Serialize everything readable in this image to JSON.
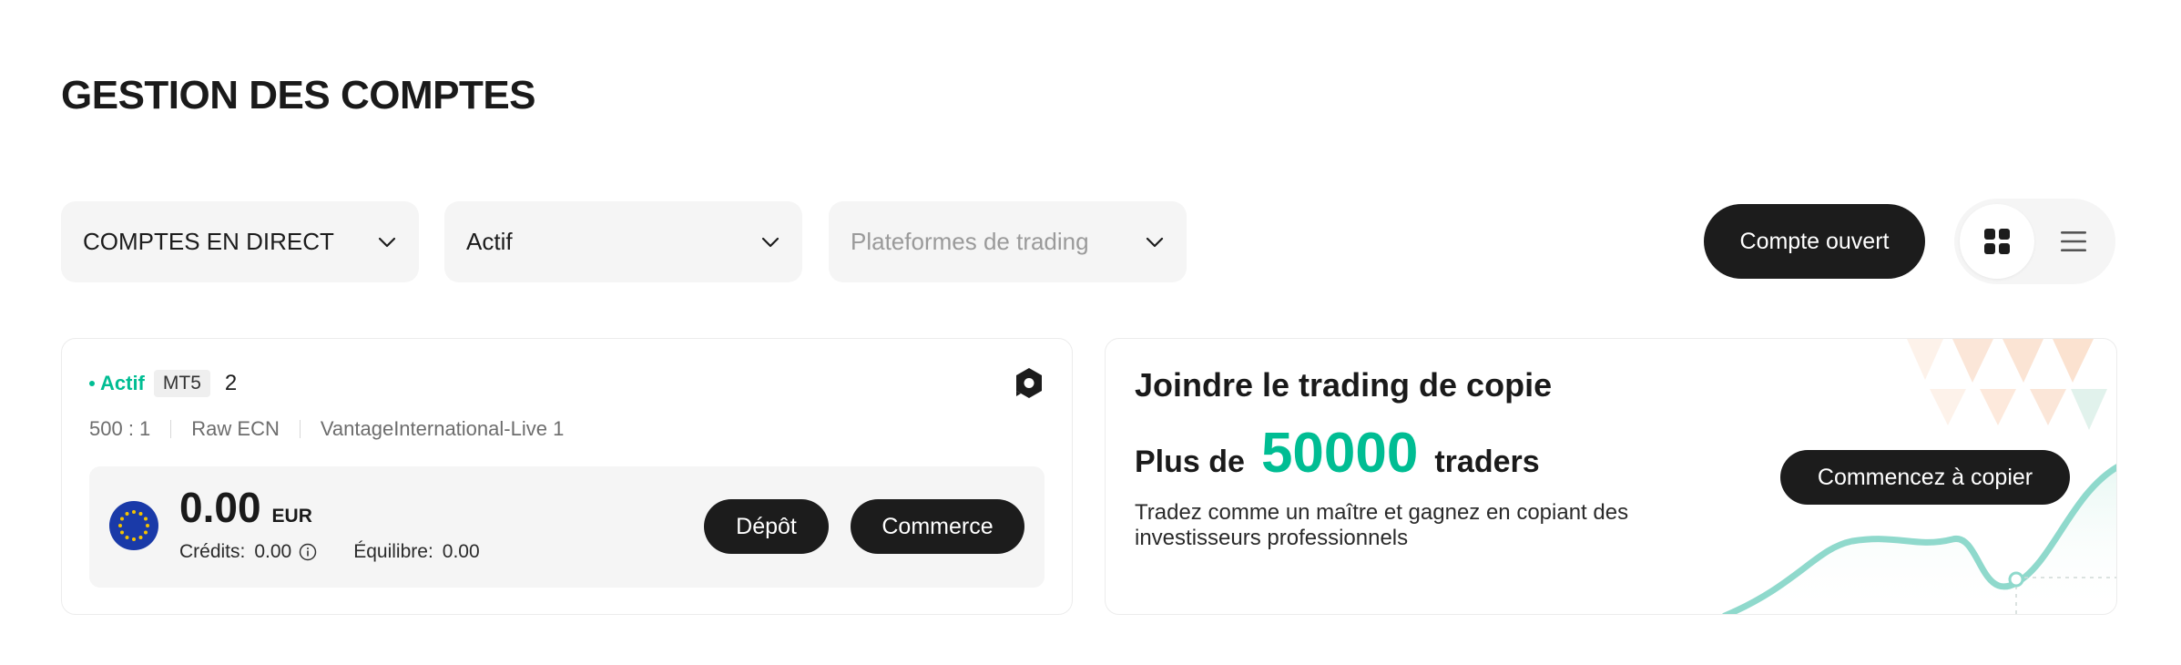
{
  "page": {
    "title": "GESTION DES COMPTES"
  },
  "filters": {
    "account_type": "COMPTES EN DIRECT",
    "status": "Actif",
    "platform_placeholder": "Plateformes de trading"
  },
  "toolbar": {
    "open_account_label": "Compte ouvert",
    "view_mode": "grid"
  },
  "account": {
    "status": "Actif",
    "platform": "MT5",
    "number": "2",
    "leverage": "500 : 1",
    "account_type": "Raw ECN",
    "server": "VantageInternational-Live 1",
    "balance": "0.00",
    "currency": "EUR",
    "credits_label": "Crédits:",
    "credits_value": "0.00",
    "equity_label": "Équilibre:",
    "equity_value": "0.00",
    "deposit_label": "Dépôt",
    "trade_label": "Commerce"
  },
  "promo": {
    "title": "Joindre le trading de copie",
    "prefix": "Plus de",
    "count": "50000",
    "suffix": "traders",
    "description": "Tradez comme un maître et gagnez en copiant des investisseurs professionnels",
    "cta_label": "Commencez à copier"
  },
  "colors": {
    "accent": "#00bd93",
    "button_dark": "#1c1c1c",
    "panel_bg": "#f5f5f5"
  }
}
